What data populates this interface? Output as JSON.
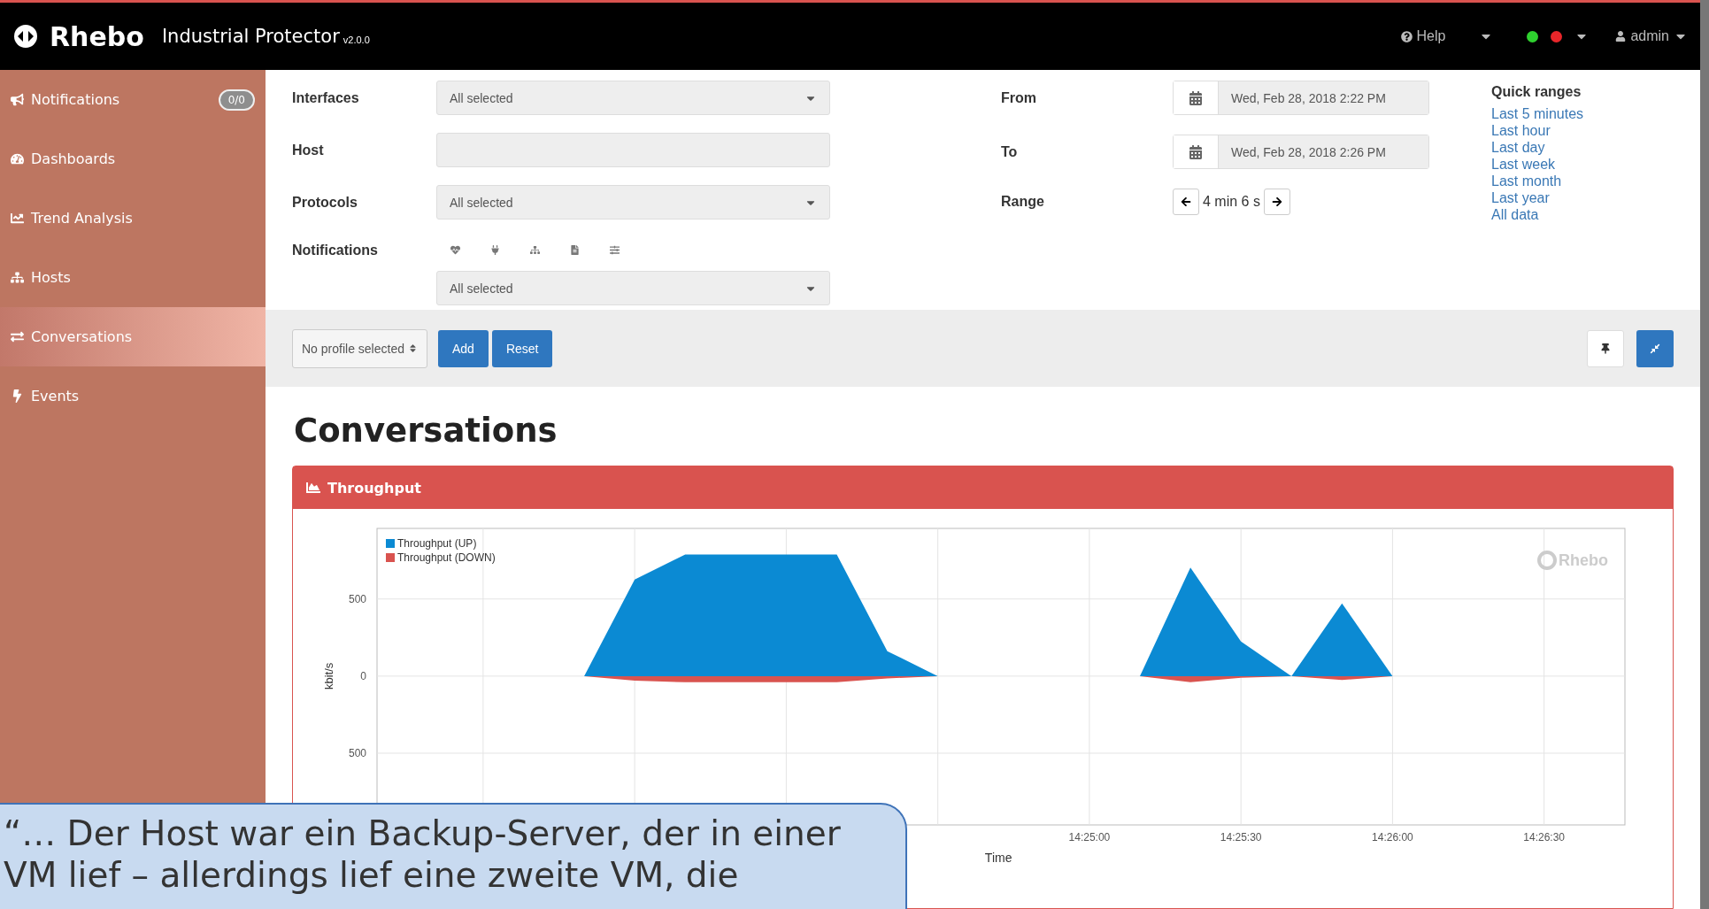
{
  "topbar": {
    "brand": "Rhebo",
    "product": "Industrial Protector",
    "version": "v2.0.0",
    "help": "Help",
    "status_dots": [
      {
        "color": "#2fd12f"
      },
      {
        "color": "#e8262a"
      }
    ],
    "user": "admin"
  },
  "sidebar": {
    "items": [
      {
        "label": "Notifications",
        "badge": "0/0",
        "selected": false
      },
      {
        "label": "Dashboards",
        "selected": false
      },
      {
        "label": "Trend Analysis",
        "selected": false
      },
      {
        "label": "Hosts",
        "selected": false
      },
      {
        "label": "Conversations",
        "selected": true
      },
      {
        "label": "Events",
        "selected": false
      }
    ]
  },
  "filters": {
    "interfaces": {
      "label": "Interfaces",
      "value": "All selected"
    },
    "host": {
      "label": "Host"
    },
    "protocols": {
      "label": "Protocols",
      "value": "All selected"
    },
    "notifications": {
      "label": "Notifications",
      "value": "All selected"
    },
    "from": {
      "label": "From",
      "value": "Wed, Feb 28, 2018 2:22 PM"
    },
    "to": {
      "label": "To",
      "value": "Wed, Feb 28, 2018 2:26 PM"
    },
    "range": {
      "label": "Range",
      "value": "4 min 6 s"
    },
    "quick_ranges": {
      "title": "Quick ranges",
      "links": [
        "Last 5 minutes",
        "Last hour",
        "Last day",
        "Last week",
        "Last month",
        "Last year",
        "All data"
      ]
    }
  },
  "profile_bar": {
    "profile": "No profile selected",
    "buttons": [
      "Add",
      "Reset"
    ]
  },
  "page_title": "Conversations",
  "panel": {
    "title": "Throughput",
    "chart_logo": "Rhebo",
    "chart_data": {
      "type": "area",
      "xlabel": "Time",
      "ylabel": "kbit/s",
      "x": [
        51800,
        51810,
        51820,
        51850,
        51860,
        51870,
        51900,
        51910,
        51920,
        51930,
        51940,
        51950,
        51960
      ],
      "series": [
        {
          "name": "Throughput (UP)",
          "color": "#0b8ad3",
          "values": [
            0,
            627,
            789,
            789,
            162,
            0,
            0,
            0,
            704,
            225,
            0,
            472,
            0
          ]
        },
        {
          "name": "Throughput (DOWN)",
          "color": "#d9534f",
          "values": [
            0,
            -30,
            -40,
            -40,
            -15,
            0,
            0,
            0,
            -40,
            -10,
            0,
            -25,
            0
          ]
        }
      ],
      "grid": true,
      "legend": true,
      "xlim": [
        51759,
        52006
      ],
      "ylim": [
        -965,
        958
      ],
      "xticks": [
        {
          "value": 51900,
          "label": "14:25:00"
        },
        {
          "value": 51930,
          "label": "14:25:30"
        },
        {
          "value": 51960,
          "label": "14:26:00"
        },
        {
          "value": 51990,
          "label": "14:26:30"
        }
      ],
      "yticks": [
        {
          "value": 500,
          "label": "500"
        },
        {
          "value": 0,
          "label": "0"
        },
        {
          "value": -500,
          "label": "500"
        }
      ]
    }
  },
  "callout": {
    "lines": [
      "“… Der Host war ein Backup-Server, der in einer",
      "VM lief – allerdings lief eine zweite VM, die"
    ]
  }
}
